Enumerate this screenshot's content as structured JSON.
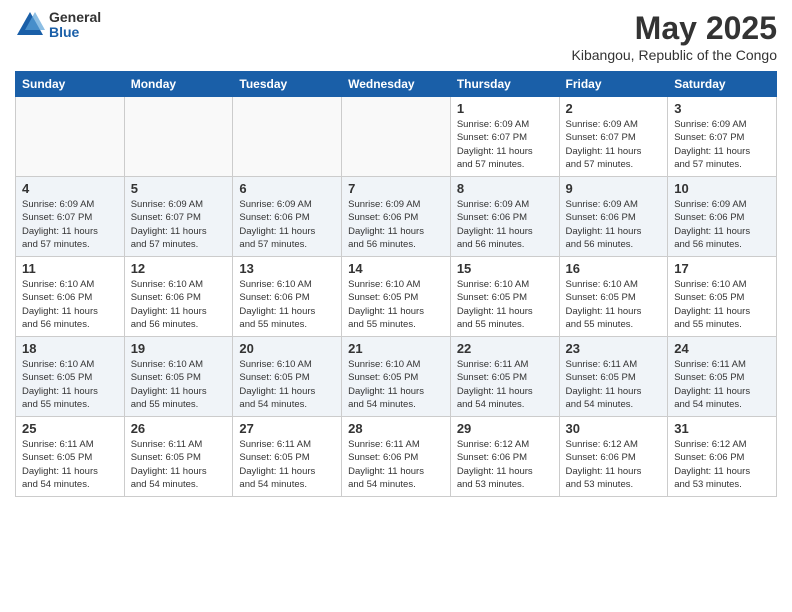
{
  "logo": {
    "general": "General",
    "blue": "Blue"
  },
  "title": "May 2025",
  "location": "Kibangou, Republic of the Congo",
  "weekdays": [
    "Sunday",
    "Monday",
    "Tuesday",
    "Wednesday",
    "Thursday",
    "Friday",
    "Saturday"
  ],
  "weeks": [
    [
      {
        "day": "",
        "info": ""
      },
      {
        "day": "",
        "info": ""
      },
      {
        "day": "",
        "info": ""
      },
      {
        "day": "",
        "info": ""
      },
      {
        "day": "1",
        "info": "Sunrise: 6:09 AM\nSunset: 6:07 PM\nDaylight: 11 hours\nand 57 minutes."
      },
      {
        "day": "2",
        "info": "Sunrise: 6:09 AM\nSunset: 6:07 PM\nDaylight: 11 hours\nand 57 minutes."
      },
      {
        "day": "3",
        "info": "Sunrise: 6:09 AM\nSunset: 6:07 PM\nDaylight: 11 hours\nand 57 minutes."
      }
    ],
    [
      {
        "day": "4",
        "info": "Sunrise: 6:09 AM\nSunset: 6:07 PM\nDaylight: 11 hours\nand 57 minutes."
      },
      {
        "day": "5",
        "info": "Sunrise: 6:09 AM\nSunset: 6:07 PM\nDaylight: 11 hours\nand 57 minutes."
      },
      {
        "day": "6",
        "info": "Sunrise: 6:09 AM\nSunset: 6:06 PM\nDaylight: 11 hours\nand 57 minutes."
      },
      {
        "day": "7",
        "info": "Sunrise: 6:09 AM\nSunset: 6:06 PM\nDaylight: 11 hours\nand 56 minutes."
      },
      {
        "day": "8",
        "info": "Sunrise: 6:09 AM\nSunset: 6:06 PM\nDaylight: 11 hours\nand 56 minutes."
      },
      {
        "day": "9",
        "info": "Sunrise: 6:09 AM\nSunset: 6:06 PM\nDaylight: 11 hours\nand 56 minutes."
      },
      {
        "day": "10",
        "info": "Sunrise: 6:09 AM\nSunset: 6:06 PM\nDaylight: 11 hours\nand 56 minutes."
      }
    ],
    [
      {
        "day": "11",
        "info": "Sunrise: 6:10 AM\nSunset: 6:06 PM\nDaylight: 11 hours\nand 56 minutes."
      },
      {
        "day": "12",
        "info": "Sunrise: 6:10 AM\nSunset: 6:06 PM\nDaylight: 11 hours\nand 56 minutes."
      },
      {
        "day": "13",
        "info": "Sunrise: 6:10 AM\nSunset: 6:06 PM\nDaylight: 11 hours\nand 55 minutes."
      },
      {
        "day": "14",
        "info": "Sunrise: 6:10 AM\nSunset: 6:05 PM\nDaylight: 11 hours\nand 55 minutes."
      },
      {
        "day": "15",
        "info": "Sunrise: 6:10 AM\nSunset: 6:05 PM\nDaylight: 11 hours\nand 55 minutes."
      },
      {
        "day": "16",
        "info": "Sunrise: 6:10 AM\nSunset: 6:05 PM\nDaylight: 11 hours\nand 55 minutes."
      },
      {
        "day": "17",
        "info": "Sunrise: 6:10 AM\nSunset: 6:05 PM\nDaylight: 11 hours\nand 55 minutes."
      }
    ],
    [
      {
        "day": "18",
        "info": "Sunrise: 6:10 AM\nSunset: 6:05 PM\nDaylight: 11 hours\nand 55 minutes."
      },
      {
        "day": "19",
        "info": "Sunrise: 6:10 AM\nSunset: 6:05 PM\nDaylight: 11 hours\nand 55 minutes."
      },
      {
        "day": "20",
        "info": "Sunrise: 6:10 AM\nSunset: 6:05 PM\nDaylight: 11 hours\nand 54 minutes."
      },
      {
        "day": "21",
        "info": "Sunrise: 6:10 AM\nSunset: 6:05 PM\nDaylight: 11 hours\nand 54 minutes."
      },
      {
        "day": "22",
        "info": "Sunrise: 6:11 AM\nSunset: 6:05 PM\nDaylight: 11 hours\nand 54 minutes."
      },
      {
        "day": "23",
        "info": "Sunrise: 6:11 AM\nSunset: 6:05 PM\nDaylight: 11 hours\nand 54 minutes."
      },
      {
        "day": "24",
        "info": "Sunrise: 6:11 AM\nSunset: 6:05 PM\nDaylight: 11 hours\nand 54 minutes."
      }
    ],
    [
      {
        "day": "25",
        "info": "Sunrise: 6:11 AM\nSunset: 6:05 PM\nDaylight: 11 hours\nand 54 minutes."
      },
      {
        "day": "26",
        "info": "Sunrise: 6:11 AM\nSunset: 6:05 PM\nDaylight: 11 hours\nand 54 minutes."
      },
      {
        "day": "27",
        "info": "Sunrise: 6:11 AM\nSunset: 6:05 PM\nDaylight: 11 hours\nand 54 minutes."
      },
      {
        "day": "28",
        "info": "Sunrise: 6:11 AM\nSunset: 6:06 PM\nDaylight: 11 hours\nand 54 minutes."
      },
      {
        "day": "29",
        "info": "Sunrise: 6:12 AM\nSunset: 6:06 PM\nDaylight: 11 hours\nand 53 minutes."
      },
      {
        "day": "30",
        "info": "Sunrise: 6:12 AM\nSunset: 6:06 PM\nDaylight: 11 hours\nand 53 minutes."
      },
      {
        "day": "31",
        "info": "Sunrise: 6:12 AM\nSunset: 6:06 PM\nDaylight: 11 hours\nand 53 minutes."
      }
    ]
  ]
}
